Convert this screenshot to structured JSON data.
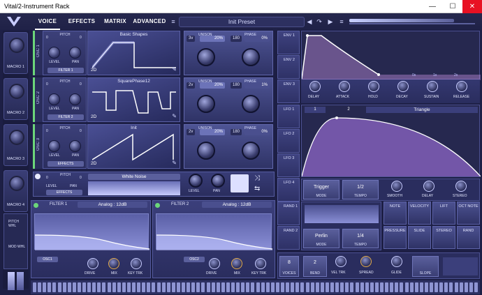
{
  "window": {
    "title": "Vital/2-Instrument Rack",
    "min": "—",
    "max": "☐",
    "close": "✕"
  },
  "nav": {
    "tabs": [
      "VOICE",
      "EFFECTS",
      "MATRIX",
      "ADVANCED"
    ],
    "active": "VOICE",
    "preset": "Init Preset"
  },
  "icons": {
    "logo": "V",
    "prev": "◀",
    "next": "▶",
    "save": "↷",
    "menu": "≡",
    "power": "⏻",
    "refresh": "↻"
  },
  "macros": [
    "MACRO 1",
    "MACRO 2",
    "MACRO 3",
    "MACRO 4",
    "PITCH WHL",
    "MOD WHL"
  ],
  "osc": [
    {
      "label": "OSC 1",
      "pitch": "PITCH",
      "p1": "0",
      "p2": "0",
      "level": "LEVEL",
      "pan": "PAN",
      "route": "FILTER 1",
      "wave": "Basic Shapes",
      "dim": "2D",
      "unison_label": "UNISON",
      "unison_v": "3v",
      "unison_p": "20%",
      "phase_label": "PHASE",
      "phase_v": "180",
      "phase_p": "0%"
    },
    {
      "label": "OSC 2",
      "pitch": "PITCH",
      "p1": "0",
      "p2": "0",
      "level": "LEVEL",
      "pan": "PAN",
      "route": "FILTER 2",
      "wave": "SquarePhase12",
      "dim": "2D",
      "unison_label": "UNISON",
      "unison_v": "2v",
      "unison_p": "20%",
      "phase_label": "PHASE",
      "phase_v": "180",
      "phase_p": "1%"
    },
    {
      "label": "OSC 3",
      "pitch": "PITCH",
      "p1": "0",
      "p2": "0",
      "level": "LEVEL",
      "pan": "PAN",
      "route": "EFFECTS",
      "wave": "Init",
      "dim": "2D",
      "unison_label": "UNISON",
      "unison_v": "2v",
      "unison_p": "20%",
      "phase_label": "PHASE",
      "phase_v": "180",
      "phase_p": "0%"
    }
  ],
  "noise": {
    "pitch": "PITCH",
    "p1": "0",
    "p2": "0",
    "level": "LEVEL",
    "pan": "PAN",
    "route": "EFFECTS",
    "name": "White Noise",
    "level2": "LEVEL",
    "pan2": "PAN"
  },
  "filters": [
    {
      "label": "FILTER 1",
      "type": "Analog : 12dB",
      "src": "OSC1",
      "drive": "DRIVE",
      "mix": "MIX",
      "key": "KEY TRK"
    },
    {
      "label": "FILTER 2",
      "type": "Analog : 12dB",
      "src": "OSC2",
      "drive": "DRIVE",
      "mix": "MIX",
      "key": "KEY TRK"
    }
  ],
  "env": {
    "labels": [
      "ENV 1",
      "ENV 2",
      "ENV 3"
    ],
    "knobs": [
      "DELAY",
      "ATTACK",
      "HOLD",
      "DECAY",
      "SUSTAIN",
      "RELEASE"
    ],
    "marks": [
      "0s",
      "1s",
      "2s"
    ]
  },
  "lfo": {
    "labels": [
      "LFO 1",
      "LFO 2",
      "LFO 3",
      "LFO 4"
    ],
    "shape": "Triangle",
    "num1": "1",
    "num2": "2",
    "trigger": "Trigger",
    "mode": "MODE",
    "rate": "1/2",
    "tempo": "TEMPO",
    "smooth": "SMOOTH",
    "delay": "DELAY",
    "stereo": "STEREO"
  },
  "rand": {
    "labels": [
      "RAND 1",
      "RAND 2"
    ],
    "type": "Perlin",
    "mode": "MODE",
    "rate": "1/4",
    "tempo": "TEMPO"
  },
  "modsrc": [
    "NOTE",
    "VELOCITY",
    "LIFT",
    "OCT NOTE",
    "PRESSURE",
    "SLIDE",
    "STEREO",
    "RAND"
  ],
  "voice": {
    "voices_v": "8",
    "voices": "VOICES",
    "bend_v": "2",
    "bend": "BEND",
    "veltrk": "VEL TRK",
    "spread": "SPREAD",
    "glide": "GLIDE",
    "slope": "SLOPE"
  },
  "colors": {
    "accent": "#6cd67a",
    "panel": "#2a2d5e",
    "bg": "#1d1f45",
    "knob_ring": "#e0a94b"
  }
}
